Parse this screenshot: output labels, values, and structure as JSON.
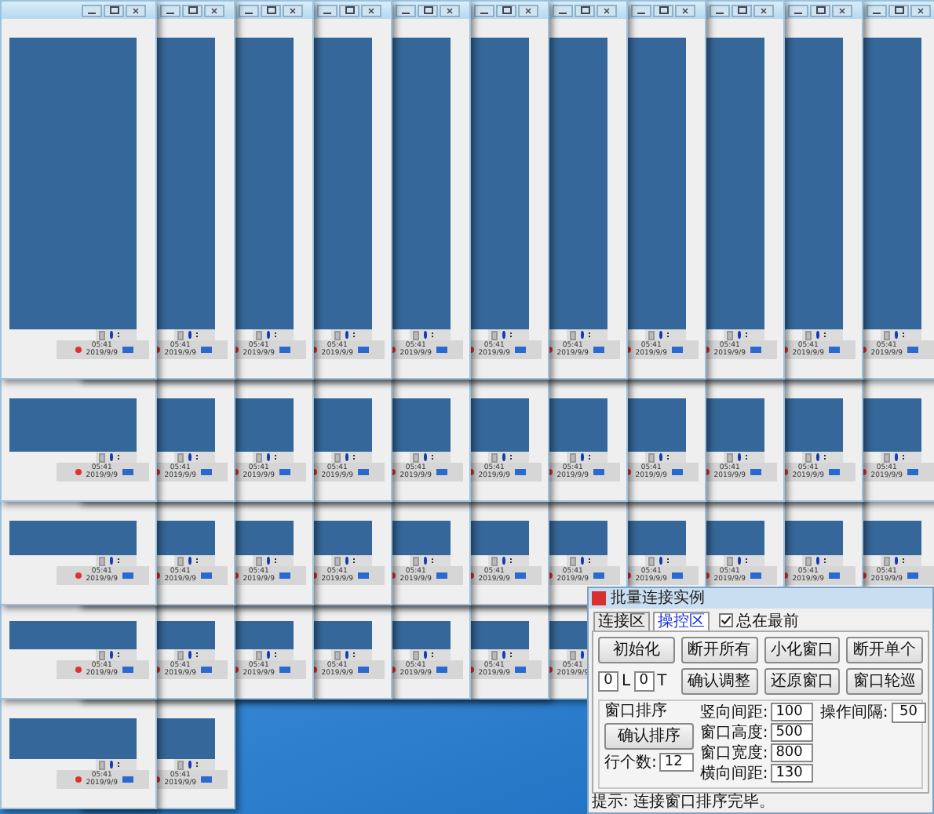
{
  "desktop": {
    "window_rows": [
      {
        "windows": [
          {
            "time": "05:41",
            "date": "2019/9/9"
          },
          {
            "time": "05:41",
            "date": "2019/9/9"
          },
          {
            "time": "05:41",
            "date": "2019/9/9"
          },
          {
            "time": "05:41",
            "date": "2019/9/9"
          },
          {
            "time": "05:41",
            "date": "2019/9/9"
          },
          {
            "time": "05:41",
            "date": "2019/9/9"
          },
          {
            "time": "05:41",
            "date": "2019/9/9"
          },
          {
            "time": "05:41",
            "date": "2019/9/9"
          },
          {
            "time": "05:41",
            "date": "2019/9/9"
          },
          {
            "time": "05:41",
            "date": "2019/9/9"
          },
          {
            "time": "05:41",
            "date": "2019/9/9"
          }
        ]
      },
      {
        "windows": [
          {
            "time": "05:41",
            "date": "2019/9/9"
          },
          {
            "time": "05:41",
            "date": "2019/9/9"
          },
          {
            "time": "05:41",
            "date": "2019/9/9"
          },
          {
            "time": "05:41",
            "date": "2019/9/9"
          },
          {
            "time": "05:41",
            "date": "2019/9/9"
          },
          {
            "time": "05:41",
            "date": "2019/9/9"
          },
          {
            "time": "05:41",
            "date": "2019/9/9"
          },
          {
            "time": "05:41",
            "date": "2019/9/9"
          },
          {
            "time": "05:41",
            "date": "2019/9/9"
          },
          {
            "time": "05:41",
            "date": "2019/9/9"
          },
          {
            "time": "05:41",
            "date": "2019/9/9"
          }
        ]
      },
      {
        "windows": [
          {
            "time": "05:41",
            "date": "2019/9/9"
          },
          {
            "time": "05:41",
            "date": "2019/9/9"
          },
          {
            "time": "05:41",
            "date": "2019/9/9"
          },
          {
            "time": "05:41",
            "date": "2019/9/9"
          },
          {
            "time": "05:41",
            "date": "2019/9/9"
          },
          {
            "time": "05:41",
            "date": "2019/9/9"
          },
          {
            "time": "05:41",
            "date": "2019/9/9"
          },
          {
            "time": "05:41",
            "date": "2019/9/9"
          },
          {
            "time": "05:41",
            "date": "2019/9/9"
          },
          {
            "time": "05:41",
            "date": "2019/9/9"
          },
          {
            "time": "05:41",
            "date": "2019/9/9"
          }
        ]
      },
      {
        "windows": [
          {
            "time": "05:41",
            "date": "2019/9/9"
          },
          {
            "time": "05:41",
            "date": "2019/9/9"
          },
          {
            "time": "05:41",
            "date": "2019/9/9"
          },
          {
            "time": "05:41",
            "date": "2019/9/9"
          },
          {
            "time": "05:41",
            "date": "2019/9/9"
          },
          {
            "time": "05:41",
            "date": "2019/9/9"
          },
          {
            "time": "05:41",
            "date": "2019/9/9"
          }
        ]
      },
      {
        "windows": [
          {
            "time": "05:41",
            "date": "2019/9/9"
          },
          {
            "time": "05:41",
            "date": "2019/9/9"
          }
        ]
      }
    ]
  },
  "dialog": {
    "title": "批量连接实例",
    "tabs": [
      {
        "label": "连接区",
        "selected": false
      },
      {
        "label": "操控区",
        "selected": true
      }
    ],
    "always_on_top": {
      "label": "总在最前",
      "checked": true
    },
    "buttons_row_1": [
      "初始化",
      "断开所有",
      "小化窗口",
      "断开单个"
    ],
    "offset": {
      "left_value": "0",
      "left_label": "L",
      "top_value": "0",
      "top_label": "T"
    },
    "buttons_row_2": [
      "确认调整",
      "还原窗口",
      "窗口轮巡"
    ],
    "sort_group": {
      "title": "窗口排序",
      "button": "确认排序",
      "per_row": {
        "label": "行个数:",
        "value": "12"
      },
      "fields": [
        {
          "label": "竖向间距:",
          "value": "100"
        },
        {
          "label": "窗口高度:",
          "value": "500"
        },
        {
          "label": "窗口宽度:",
          "value": "800"
        },
        {
          "label": "横向间距:",
          "value": "130"
        }
      ],
      "interval": {
        "label": "操作间隔:",
        "value": "50"
      }
    },
    "status": "提示: 连接窗口排序完毕。"
  }
}
